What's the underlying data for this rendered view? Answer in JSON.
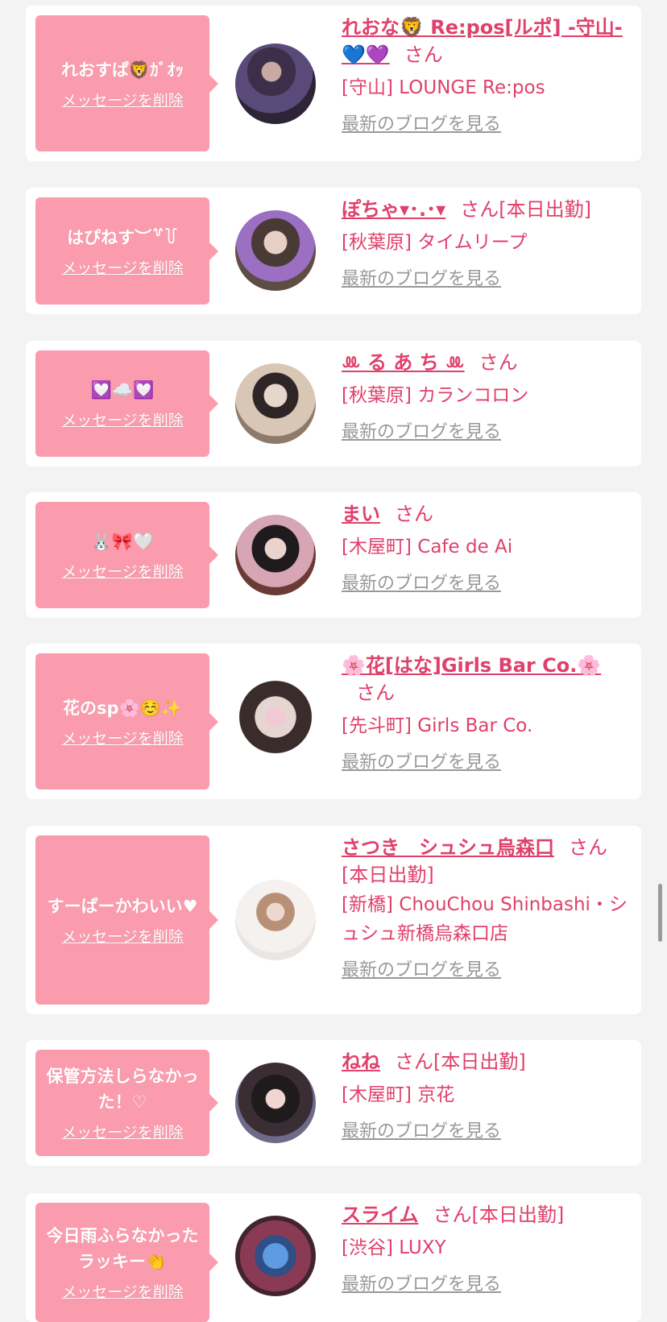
{
  "delete_label": "メッセージを削除",
  "blog_label": "最新のブログを見る",
  "san_label": "さん",
  "accent_color": "#e0406c",
  "bubble_color": "#fb9bae",
  "items": [
    {
      "message": "れおすぱ🦁ｶﾞｵｯ",
      "name": "れおな🦁 Re:pos[ルポ] -守山- 💙💜",
      "extra": "",
      "shop": "[守山] LOUNGE Re:pos"
    },
    {
      "message": "はぴねす︶꒷꒦",
      "name": "ぽちゃ▾･.･▾",
      "extra": "[本日出勤]",
      "shop": "[秋葉原] タイムリープ"
    },
    {
      "message": "💟☁️💟",
      "name": "ꔛ る あ ち ꔛ",
      "extra": "",
      "shop": "[秋葉原] カランコロン"
    },
    {
      "message": "🐰🎀🤍",
      "name": "まい",
      "extra": "",
      "shop": "[木屋町] Cafe de Ai"
    },
    {
      "message": "花のsp🌸☺️✨",
      "name": "🌸花[はな]Girls Bar Co.🌸",
      "extra": "",
      "shop": "[先斗町] Girls Bar Co."
    },
    {
      "message": "すーぱーかわいい♥",
      "name": "さつき　シュシュ烏森口",
      "extra": "[本日出勤]",
      "shop": "[新橋] ChouChou Shinbashi・シュシュ新橋烏森口店"
    },
    {
      "message": "保管方法しらなかった！♡",
      "name": "ねね",
      "extra": "[本日出勤]",
      "shop": "[木屋町] 京花"
    },
    {
      "message": "今日雨ふらなかったラッキー👏",
      "name": "スライム",
      "extra": "[本日出勤]",
      "shop": "[渋谷] LUXY"
    }
  ]
}
